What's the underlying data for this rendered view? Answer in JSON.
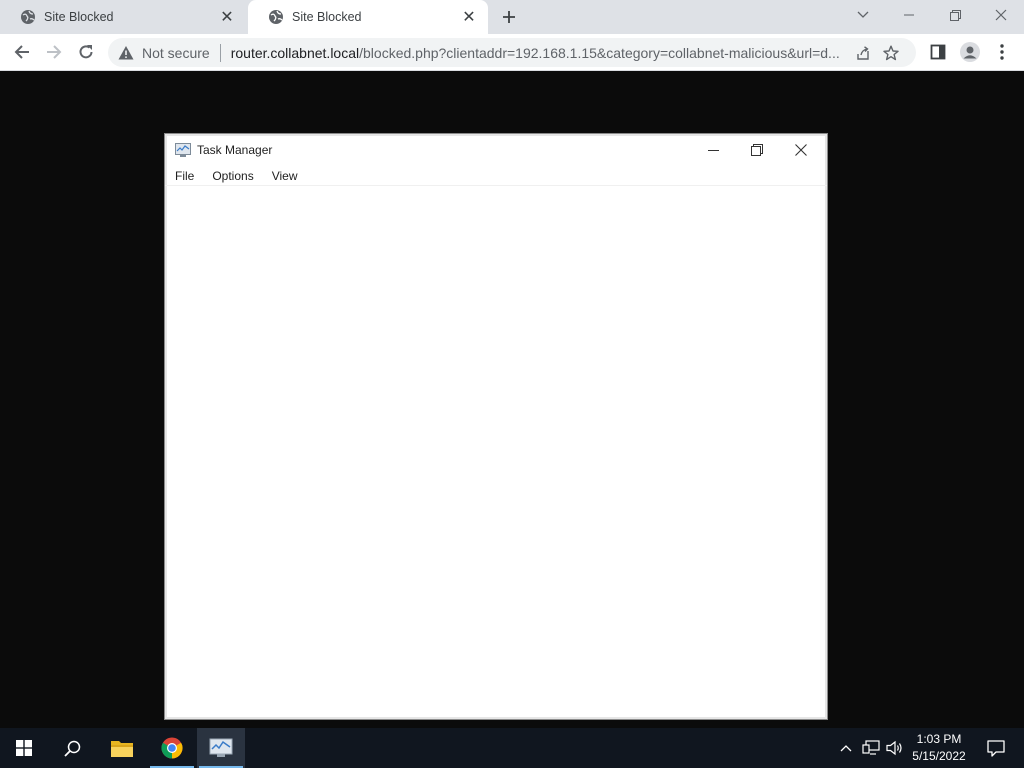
{
  "browser": {
    "tabs": [
      {
        "title": "Site Blocked",
        "active": false,
        "icon": "globe-icon"
      },
      {
        "title": "Site Blocked",
        "active": true,
        "icon": "globe-icon"
      }
    ],
    "address_bar": {
      "security_label": "Not secure",
      "url_host": "router.collabnet.local",
      "url_rest": "/blocked.php?clientaddr=192.168.1.15&category=collabnet-malicious&url=d..."
    }
  },
  "task_manager": {
    "title": "Task Manager",
    "menu": [
      "File",
      "Options",
      "View"
    ]
  },
  "taskbar": {
    "apps": [
      "start-icon",
      "search-icon",
      "file-explorer-icon",
      "chrome-icon",
      "task-manager-icon"
    ],
    "clock": {
      "time": "1:03 PM",
      "date": "5/15/2022"
    }
  },
  "colors": {
    "tabstrip": "#dee1e6",
    "page_background": "#0b0b0b",
    "taskbar": "#10161f",
    "taskbar_running_indicator": "#76b9ed"
  }
}
